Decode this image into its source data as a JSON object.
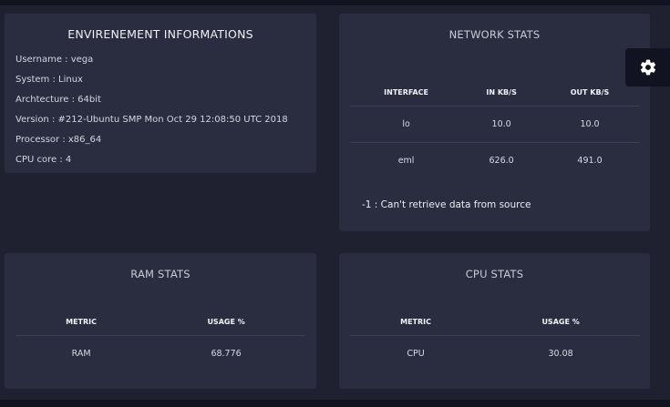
{
  "env": {
    "title": "ENVIRENEMENT INFORMATIONS",
    "lines": [
      "Username : vega",
      "System : Linux",
      "Archtecture : 64bit",
      "Version : #212-Ubuntu SMP Mon Oct 29 12:08:50 UTC 2018",
      "Processor : x86_64",
      "CPU core : 4"
    ]
  },
  "network": {
    "title": "NETWORK STATS",
    "headers": [
      "INTERFACE",
      "IN KB/S",
      "OUT KB/S"
    ],
    "rows": [
      [
        "lo",
        "10.0",
        "10.0"
      ],
      [
        "eml",
        "626.0",
        "491.0"
      ]
    ],
    "error": "-1 : Can't retrieve data from source"
  },
  "ram": {
    "title": "RAM STATS",
    "headers": [
      "METRIC",
      "USAGE %"
    ],
    "rows": [
      [
        "RAM",
        "68.776"
      ]
    ]
  },
  "cpu": {
    "title": "CPU STATS",
    "headers": [
      "METRIC",
      "USAGE %"
    ],
    "rows": [
      [
        "CPU",
        "30.08"
      ]
    ]
  },
  "icons": {
    "settings": "gear-icon"
  },
  "colors": {
    "background": "#1f2030",
    "card": "#2a2c40",
    "bar": "#121320"
  }
}
